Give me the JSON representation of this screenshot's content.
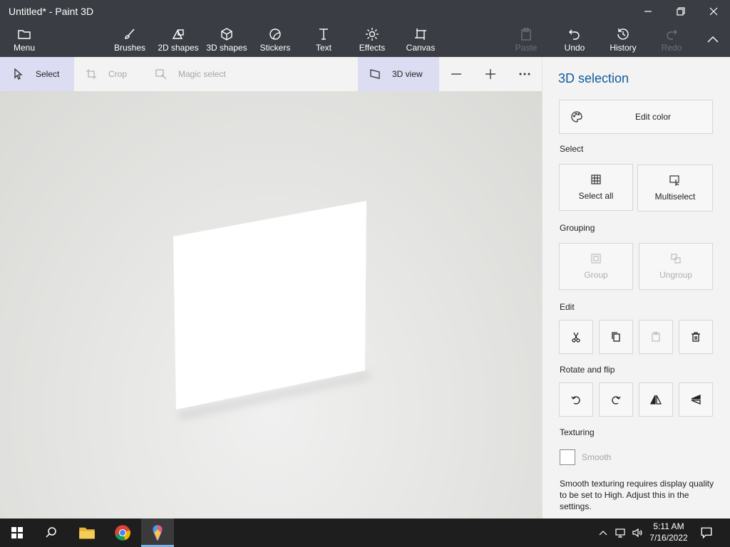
{
  "window": {
    "title": "Untitled* - Paint 3D"
  },
  "ribbon": {
    "menu": "Menu",
    "brushes": "Brushes",
    "shapes2d": "2D shapes",
    "shapes3d": "3D shapes",
    "stickers": "Stickers",
    "text": "Text",
    "effects": "Effects",
    "canvas": "Canvas",
    "paste": "Paste",
    "undo": "Undo",
    "history": "History",
    "redo": "Redo"
  },
  "toolbar": {
    "select": "Select",
    "crop": "Crop",
    "magic_select": "Magic select",
    "view3d": "3D view"
  },
  "panel": {
    "title": "3D selection",
    "edit_color": "Edit color",
    "select_section": "Select",
    "select_all": "Select all",
    "multiselect": "Multiselect",
    "grouping_section": "Grouping",
    "group": "Group",
    "ungroup": "Ungroup",
    "edit_section": "Edit",
    "rotate_section": "Rotate and flip",
    "texturing_section": "Texturing",
    "smooth": "Smooth",
    "smooth_note": "Smooth texturing requires display quality to be set to High. Adjust this in the settings."
  },
  "taskbar": {
    "time": "5:11 AM",
    "date": "7/16/2022"
  },
  "colors": {
    "chrome": "#3b3d44",
    "accent": "#0e5a9c",
    "select_highlight": "#dcdcf2"
  }
}
